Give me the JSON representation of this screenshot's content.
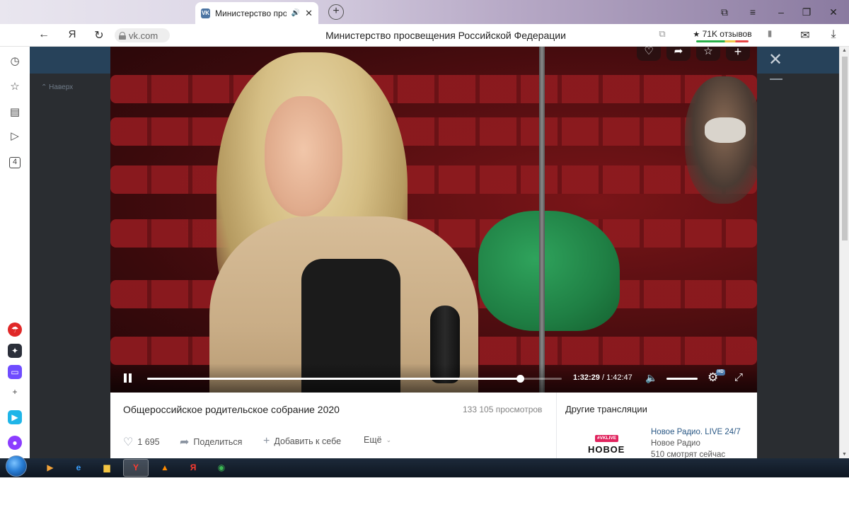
{
  "browser": {
    "tab": {
      "title": "Министерство просвещения Российской Федерации",
      "favicon_text": "VK",
      "audio_icon": "speaker-icon",
      "close_icon": "close-icon"
    },
    "new_tab": "+",
    "window_controls": {
      "bookmarks_icon": "bookmarks-icon",
      "menu_icon": "menu-icon",
      "minimize": "–",
      "restore": "❐",
      "close": "✕"
    },
    "nav": {
      "back": "←",
      "yandex": "Я",
      "reload": "↻"
    },
    "address": {
      "url": "vk.com",
      "page_title": "Министерство просвещения Российской Федерации"
    },
    "reviews": {
      "star": "★",
      "label": "71K отзывов"
    },
    "toolbar_icons": {
      "copy": "⧉",
      "bookmark": "▮",
      "chat": "✉",
      "download": "⤓"
    }
  },
  "side_panel": {
    "items": [
      {
        "name": "history-icon",
        "glyph": "◷"
      },
      {
        "name": "favorites-icon",
        "glyph": "☆"
      },
      {
        "name": "collections-icon",
        "glyph": "▤"
      },
      {
        "name": "video-icon",
        "glyph": "▷"
      },
      {
        "name": "tabs-count-icon",
        "glyph": "4"
      }
    ],
    "apps": [
      {
        "name": "umbrella-app-icon",
        "glyph": "☂",
        "color": "#e02828"
      },
      {
        "name": "sparkle-app-icon",
        "glyph": "✦",
        "color": "#2b2f3a"
      },
      {
        "name": "messenger-app-icon",
        "glyph": "▭",
        "color": "#6f4cff"
      },
      {
        "name": "add-app-icon",
        "glyph": "+",
        "color": "#ffffff"
      },
      {
        "name": "send-app-icon",
        "glyph": "▶",
        "color": "#1fb5e8"
      },
      {
        "name": "alice-app-icon",
        "glyph": "●",
        "color": "#8b3dff"
      }
    ]
  },
  "page": {
    "back_link": "Наверх",
    "close_layer": "✕"
  },
  "video": {
    "actions": {
      "like": "♡",
      "share": "➦",
      "favorite": "☆",
      "add": "+"
    },
    "controls": {
      "current_time": "1:32:29",
      "separator": " / ",
      "total_time": "1:42:47",
      "progress_fraction": 0.9,
      "volume_fraction": 1.0,
      "volume_icon": "◀",
      "settings_icon": "⚙",
      "hd_label": "HD",
      "fullscreen_icon": "⤢"
    },
    "info": {
      "title": "Общероссийское родительское собрание 2020",
      "views": "133 105 просмотров",
      "likes": "1 695",
      "share_label": "Поделиться",
      "add_label": "Добавить к себе",
      "more_label": "Ещё"
    }
  },
  "other_streams": {
    "heading": "Другие трансляции",
    "items": [
      {
        "badge": "#VKLIVE",
        "logo": "НОВОЕ",
        "name": "Новое Радио. LIVE 24/7",
        "owner": "Новое Радио",
        "watchers": "510 смотрят сейчас"
      }
    ]
  },
  "taskbar": {
    "apps": [
      {
        "name": "media-player-icon",
        "glyph": "▶",
        "color": "#f2a33a"
      },
      {
        "name": "internet-explorer-icon",
        "glyph": "e",
        "color": "#3aa0ff"
      },
      {
        "name": "file-explorer-icon",
        "glyph": "▆",
        "color": "#f4c542"
      },
      {
        "name": "yandex-browser-icon",
        "glyph": "Y",
        "color": "#ff3b30"
      },
      {
        "name": "avast-icon",
        "glyph": "▲",
        "color": "#ff8a00"
      },
      {
        "name": "yandex-icon",
        "glyph": "Я",
        "color": "#ff3b30"
      },
      {
        "name": "chrome-icon",
        "glyph": "◉",
        "color": "#3cba54"
      }
    ]
  }
}
